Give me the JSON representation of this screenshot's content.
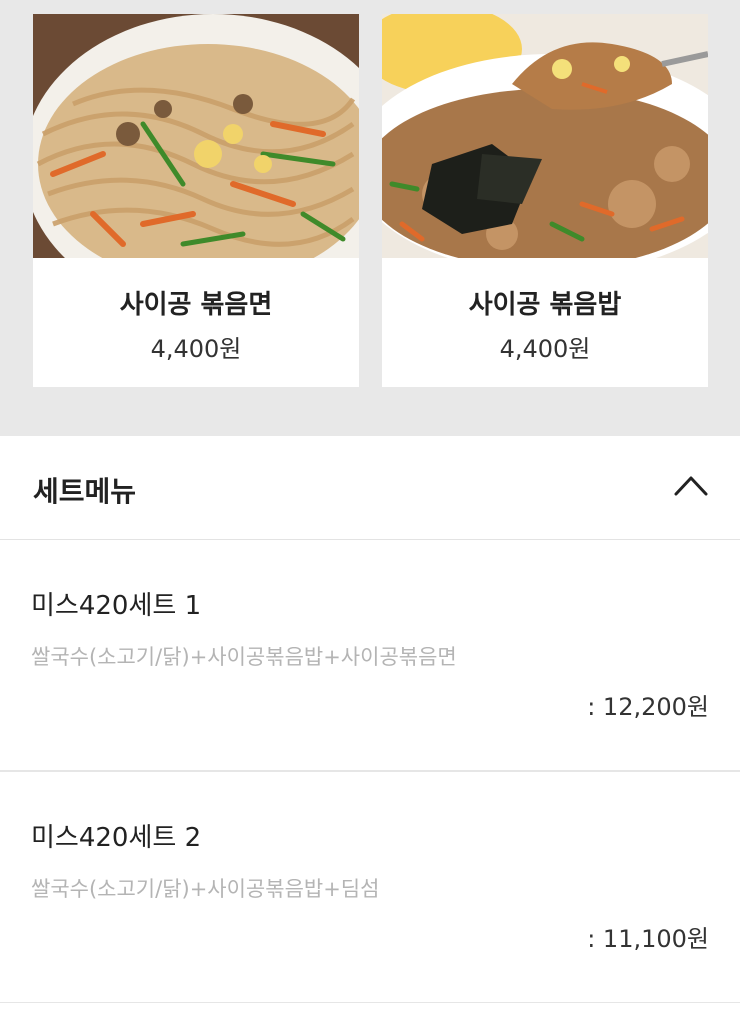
{
  "menu_cards": [
    {
      "name": "사이공 볶음면",
      "price": "4,400원",
      "image": "stir-fried-noodles-photo"
    },
    {
      "name": "사이공 볶음밥",
      "price": "4,400원",
      "image": "fried-rice-photo"
    }
  ],
  "set_section": {
    "title": "세트메뉴",
    "toggle_icon": "chevron-up-icon",
    "items": [
      {
        "name": "미스420세트 1",
        "description": "쌀국수(소고기/닭)+사이공볶음밥+사이공볶음면",
        "price": ": 12,200원"
      },
      {
        "name": "미스420세트 2",
        "description": "쌀국수(소고기/닭)+사이공볶음밥+딤섬",
        "price": ": 11,100원"
      }
    ]
  }
}
